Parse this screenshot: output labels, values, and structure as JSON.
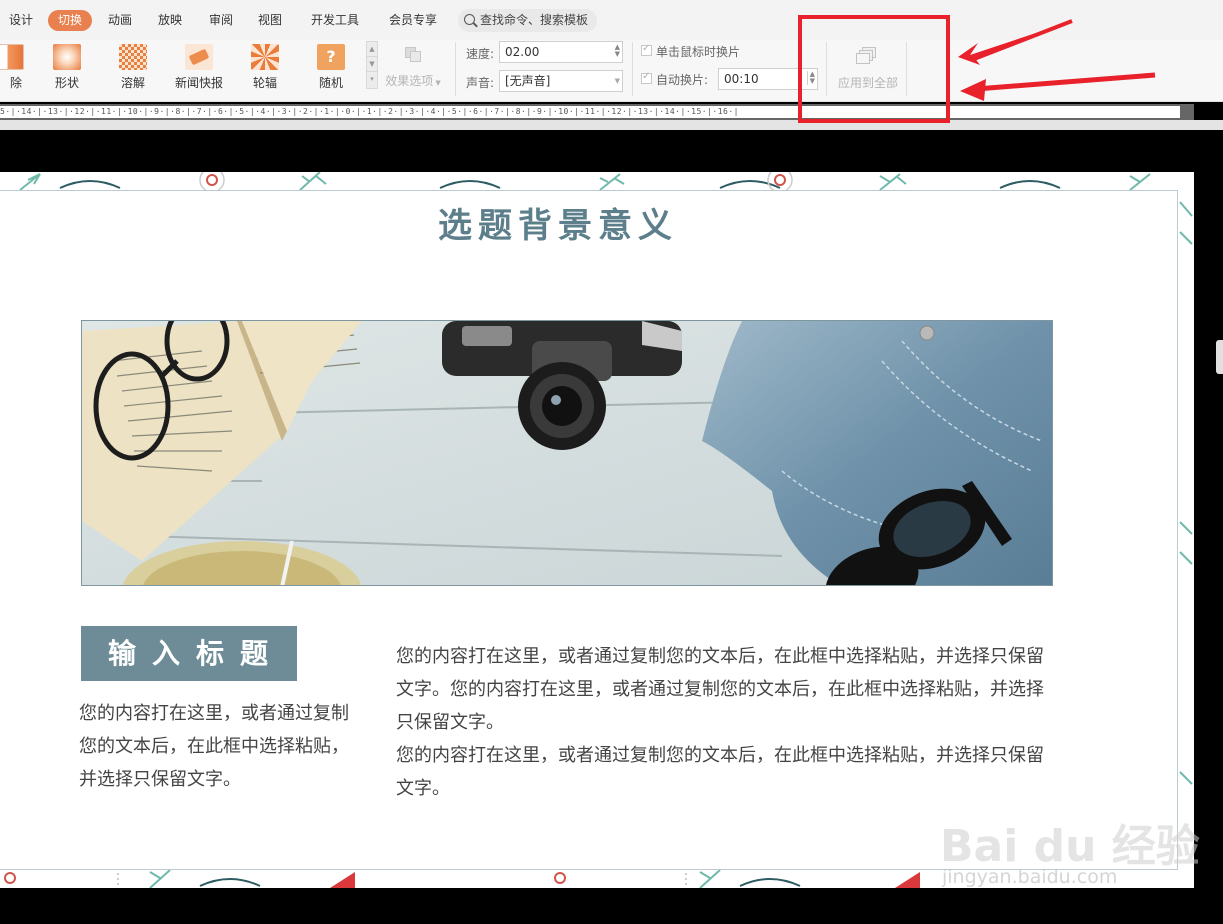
{
  "menu": {
    "tabs": [
      {
        "label": "设计"
      },
      {
        "label": "切换",
        "active": true
      },
      {
        "label": "动画"
      },
      {
        "label": "放映"
      },
      {
        "label": "审阅"
      },
      {
        "label": "视图"
      },
      {
        "label": "开发工具"
      },
      {
        "label": "会员专享"
      }
    ],
    "search_label": "查找命令、搜索模板"
  },
  "ribbon": {
    "effects": [
      {
        "label": "除",
        "icon": "erase-effect-icon"
      },
      {
        "label": "形状",
        "icon": "shape-effect-icon"
      },
      {
        "label": "溶解",
        "icon": "dissolve-effect-icon"
      },
      {
        "label": "新闻快报",
        "icon": "newsflash-effect-icon"
      },
      {
        "label": "轮辐",
        "icon": "wheel-effect-icon"
      },
      {
        "label": "随机",
        "icon": "random-effect-icon"
      }
    ],
    "effect_options_label": "效果选项",
    "speed_label": "速度:",
    "speed_value": "02.00",
    "sound_label": "声音:",
    "sound_value": "[无声音]",
    "on_click_label": "单击鼠标时换片",
    "auto_label": "自动换片:",
    "auto_value": "00:10",
    "apply_all_label": "应用到全部"
  },
  "ruler": {
    "labels": "5·|·14·|·13·|·12·|·11·|·10·|·9·|·8·|·7·|·6·|·5·|·4·|·3·|·2·|·1·|·0·|·1·|·2·|·3·|·4·|·5·|·6·|·7·|·8·|·9·|·10·|·11·|·12·|·13·|·14·|·15·|·16·|"
  },
  "slide": {
    "title": "选题背景意义",
    "subtitle_box": "输入标题",
    "left_text": "您的内容打在这里，或者通过复制您的文本后，在此框中选择粘贴，并选择只保留文字。",
    "right_para1": "您的内容打在这里，或者通过复制您的文本后，在此框中选择粘贴，并选择只保留文字。您的内容打在这里，或者通过复制您的文本后，在此框中选择粘贴，并选择只保留文字。",
    "right_para2": "您的内容打在这里，或者通过复制您的文本后，在此框中选择粘贴，并选择只保留文字。"
  },
  "watermark": {
    "brand": "Bai du 经验",
    "url": "jingyan.baidu.com"
  },
  "colors": {
    "accent": "#e8804f",
    "slide_title": "#5d7f8b",
    "subtitle_box": "#6d8c97",
    "highlight": "#e8212b"
  }
}
